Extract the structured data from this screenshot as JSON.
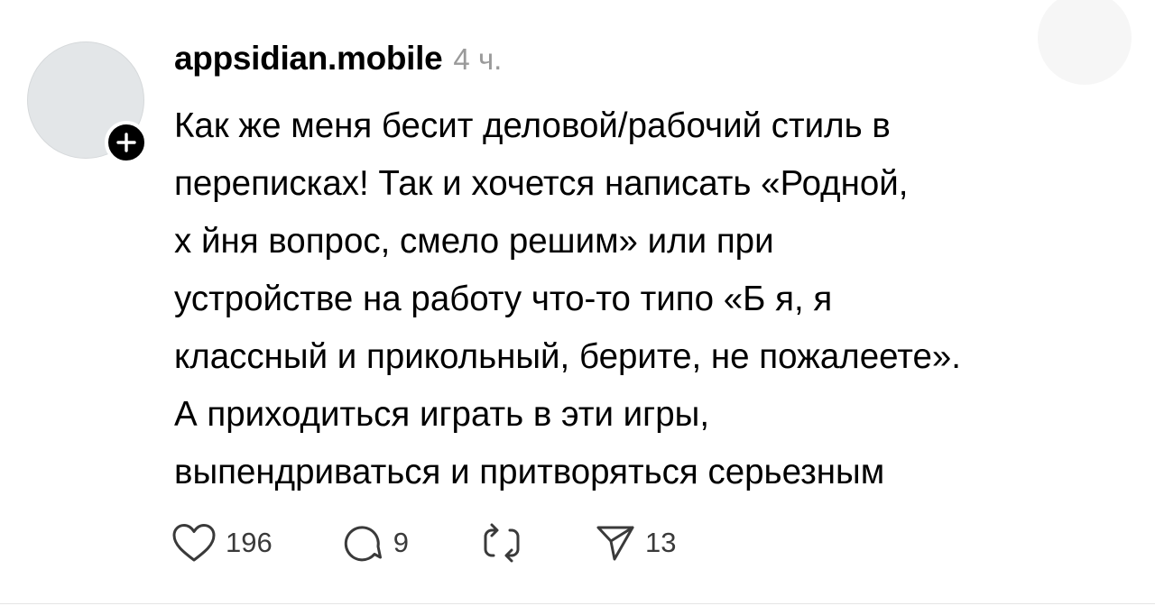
{
  "post": {
    "author": {
      "username": "appsidian.mobile",
      "time_ago": "4 ч.",
      "avatar_icon": "user-avatar-placeholder",
      "follow_icon": "plus-icon"
    },
    "text_lines": [
      "Как же меня бесит деловой/рабочий стиль в",
      "переписках! Так и хочется написать «Родной,",
      "х  йня вопрос, смело решим» или при",
      "устройстве на работу что-то типо «Б  я, я",
      "классный и прикольный, берите, не пожалеете».",
      "А приходиться играть в эти игры,",
      "выпендриваться и притворяться серьезным"
    ],
    "actions": {
      "like": {
        "icon": "heart-icon",
        "count": "196"
      },
      "reply": {
        "icon": "comment-bubble-icon",
        "count": "9"
      },
      "repost": {
        "icon": "repost-icon"
      },
      "share": {
        "icon": "send-icon",
        "count": "13"
      }
    }
  },
  "colors": {
    "text": "#000000",
    "muted": "#9a9a9a",
    "icon": "#3a3a3a",
    "avatar": "#e3e6e8"
  }
}
